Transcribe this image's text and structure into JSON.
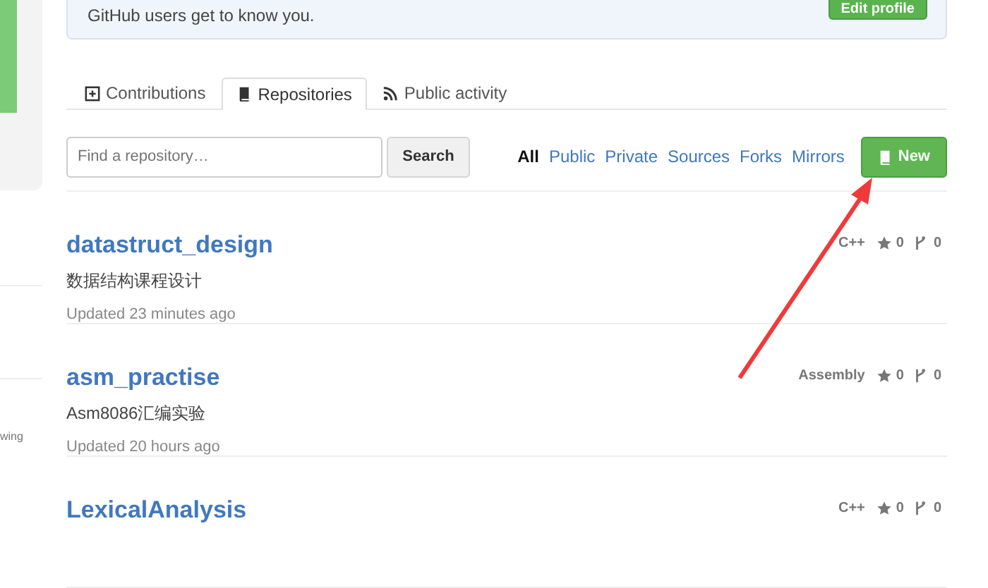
{
  "profile_tip": {
    "text": "GitHub users get to know you.",
    "button": "Edit profile"
  },
  "sidebar": {
    "cut_label": "wing"
  },
  "tabs": [
    {
      "label": "Contributions",
      "selected": false
    },
    {
      "label": "Repositories",
      "selected": true
    },
    {
      "label": "Public activity",
      "selected": false
    }
  ],
  "search": {
    "placeholder": "Find a repository…",
    "button": "Search"
  },
  "filters": [
    {
      "label": "All",
      "selected": true
    },
    {
      "label": "Public",
      "selected": false
    },
    {
      "label": "Private",
      "selected": false
    },
    {
      "label": "Sources",
      "selected": false
    },
    {
      "label": "Forks",
      "selected": false
    },
    {
      "label": "Mirrors",
      "selected": false
    }
  ],
  "new_button": "New",
  "repositories": [
    {
      "name": "datastruct_design",
      "description": "数据结构课程设计",
      "updated": "Updated 23 minutes ago",
      "language": "C++",
      "stars": "0",
      "forks": "0"
    },
    {
      "name": "asm_practise",
      "description": "Asm8086汇编实验",
      "updated": "Updated 20 hours ago",
      "language": "Assembly",
      "stars": "0",
      "forks": "0"
    },
    {
      "name": "LexicalAnalysis",
      "language": "C++",
      "stars": "0",
      "forks": "0"
    }
  ]
}
